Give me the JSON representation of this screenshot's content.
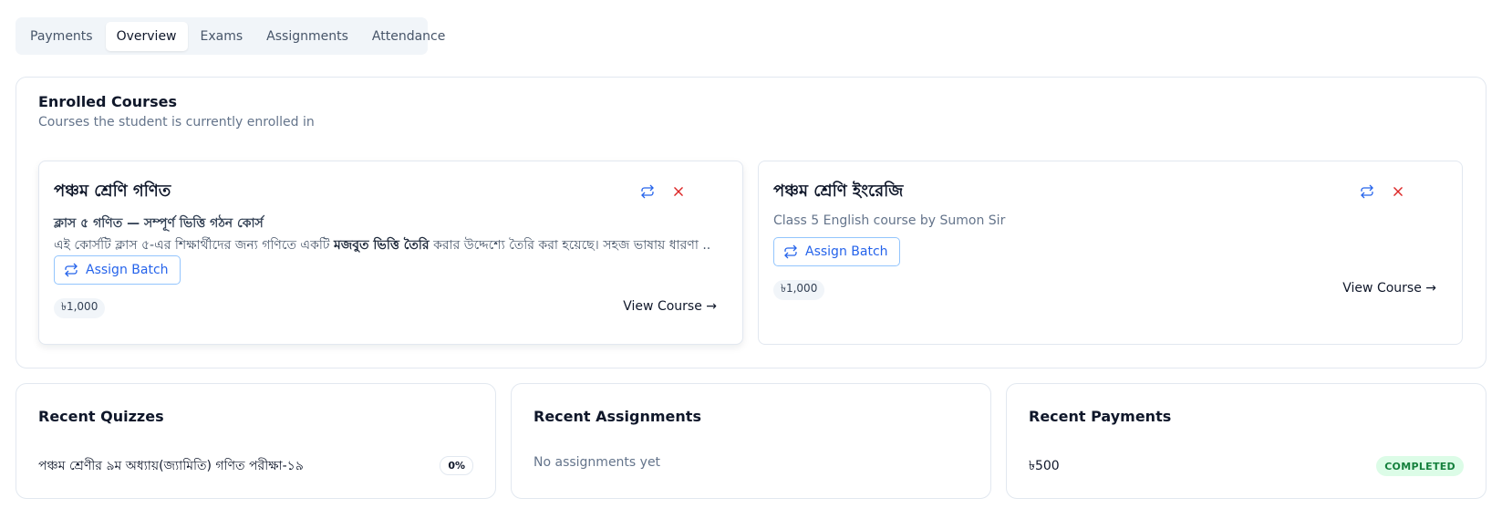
{
  "tabs": [
    {
      "label": "Payments"
    },
    {
      "label": "Overview"
    },
    {
      "label": "Exams"
    },
    {
      "label": "Assignments"
    },
    {
      "label": "Attendance"
    }
  ],
  "active_tab": "Overview",
  "enrolled": {
    "title": "Enrolled Courses",
    "subtitle": "Courses the student is currently enrolled in",
    "courses": [
      {
        "title": "পঞ্চম শ্রেণি গণিত",
        "subtitle": "ক্লাস ৫ গণিত — সম্পূর্ণ ভিত্তি গঠন কোর্স",
        "desc_before": "এই কোর্সটি ক্লাস ৫-এর শিক্ষার্থীদের জন্য গণিতে একটি ",
        "desc_bold": "মজবুত ভিত্তি তৈরি",
        "desc_after": " করার উদ্দেশ্যে তৈরি করা হয়েছে। সহজ ভাষায় ধারণা ...",
        "assign_label": "Assign Batch",
        "price": "৳1,000",
        "view_label": "View Course →"
      },
      {
        "title": "পঞ্চম শ্রেণি ইংরেজি",
        "description": "Class 5 English course by Sumon Sir",
        "assign_label": "Assign Batch",
        "price": "৳1,000",
        "view_label": "View Course →"
      }
    ]
  },
  "quizzes": {
    "title": "Recent Quizzes",
    "items": [
      {
        "name": "পঞ্চম শ্রেণীর ৯ম অধ্যায়(জ্যামিতি) গণিত পরীক্ষা-১৯",
        "score": "0%"
      }
    ]
  },
  "assignments": {
    "title": "Recent Assignments",
    "empty": "No assignments yet"
  },
  "payments": {
    "title": "Recent Payments",
    "items": [
      {
        "amount": "৳500",
        "status": "COMPLETED"
      }
    ]
  },
  "colors": {
    "accent": "#2563eb",
    "danger": "#dc2626",
    "success_bg": "#dcfce7",
    "success_text": "#15803d"
  },
  "icons": {
    "change": "refresh-icon",
    "remove": "close-icon"
  }
}
